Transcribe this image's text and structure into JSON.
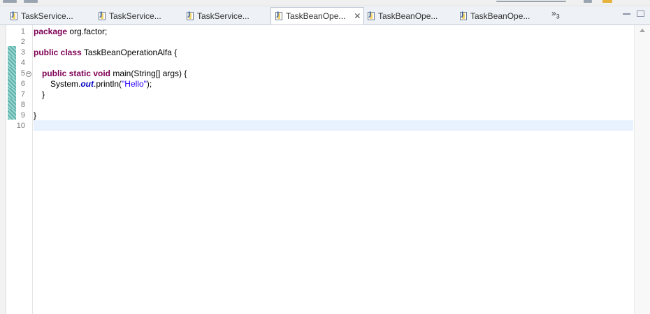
{
  "tabs": [
    {
      "label": "TaskService...",
      "icon": "java-file-icon",
      "active": false
    },
    {
      "label": "TaskService...",
      "icon": "java-file-icon",
      "active": false
    },
    {
      "label": "TaskService...",
      "icon": "java-file-icon",
      "active": false
    },
    {
      "label": "TaskBeanOpe...",
      "icon": "java-file-icon",
      "active": true,
      "close": "✕"
    },
    {
      "label": "TaskBeanOpe...",
      "icon": "java-file-icon",
      "active": false
    },
    {
      "label": "TaskBeanOpe...",
      "icon": "java-file-icon",
      "active": false
    }
  ],
  "overflow": {
    "chevron": "»",
    "count": "3"
  },
  "line_numbers": [
    "1",
    "2",
    "3",
    "4",
    "5",
    "6",
    "7",
    "8",
    "9",
    "10"
  ],
  "code": {
    "l1_kw": "package",
    "l1_rest": " org.factor;",
    "l3_kw": "public class",
    "l3_rest": " TaskBeanOperationAlfa {",
    "l5_kw": "public static void",
    "l5_rest": " main(String[] args) {",
    "l6_pre": "System.",
    "l6_field": "out",
    "l6_mid": ".println(",
    "l6_str": "\"Hello\"",
    "l6_end": ");",
    "l7": "}",
    "l9": "}"
  },
  "colors": {
    "keyword": "#7f0055",
    "string": "#2a00ff",
    "field": "#0000c0",
    "current_line": "#e8f2fe",
    "change_marker": "#5fb2ab"
  }
}
